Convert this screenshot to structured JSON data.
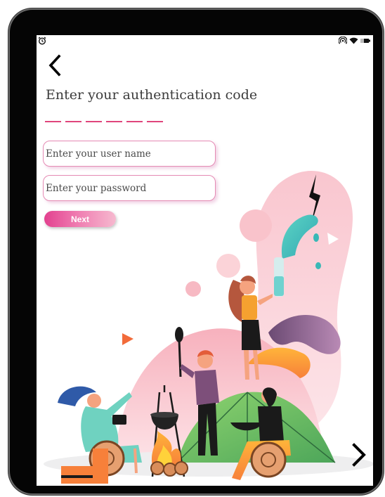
{
  "screen": {
    "title": "Enter your authentication code",
    "code_length": 6
  },
  "form": {
    "username_placeholder": "Enter your user name",
    "password_placeholder": "Enter your password",
    "next_label": "Next"
  },
  "status_bar": {
    "left_icons": [
      "alarm-icon"
    ],
    "right_icons": [
      "hotspot-icon",
      "wifi-icon",
      "battery-icon"
    ]
  },
  "navigation": {
    "back_icon": "chevron-left-icon",
    "forward_icon": "chevron-right-icon"
  },
  "colors": {
    "accent": "#e0457b",
    "button_gradient_start": "#e2418f",
    "button_gradient_end": "#f6b9cf",
    "field_border": "#e58bb4",
    "device_frame": "#050505"
  }
}
